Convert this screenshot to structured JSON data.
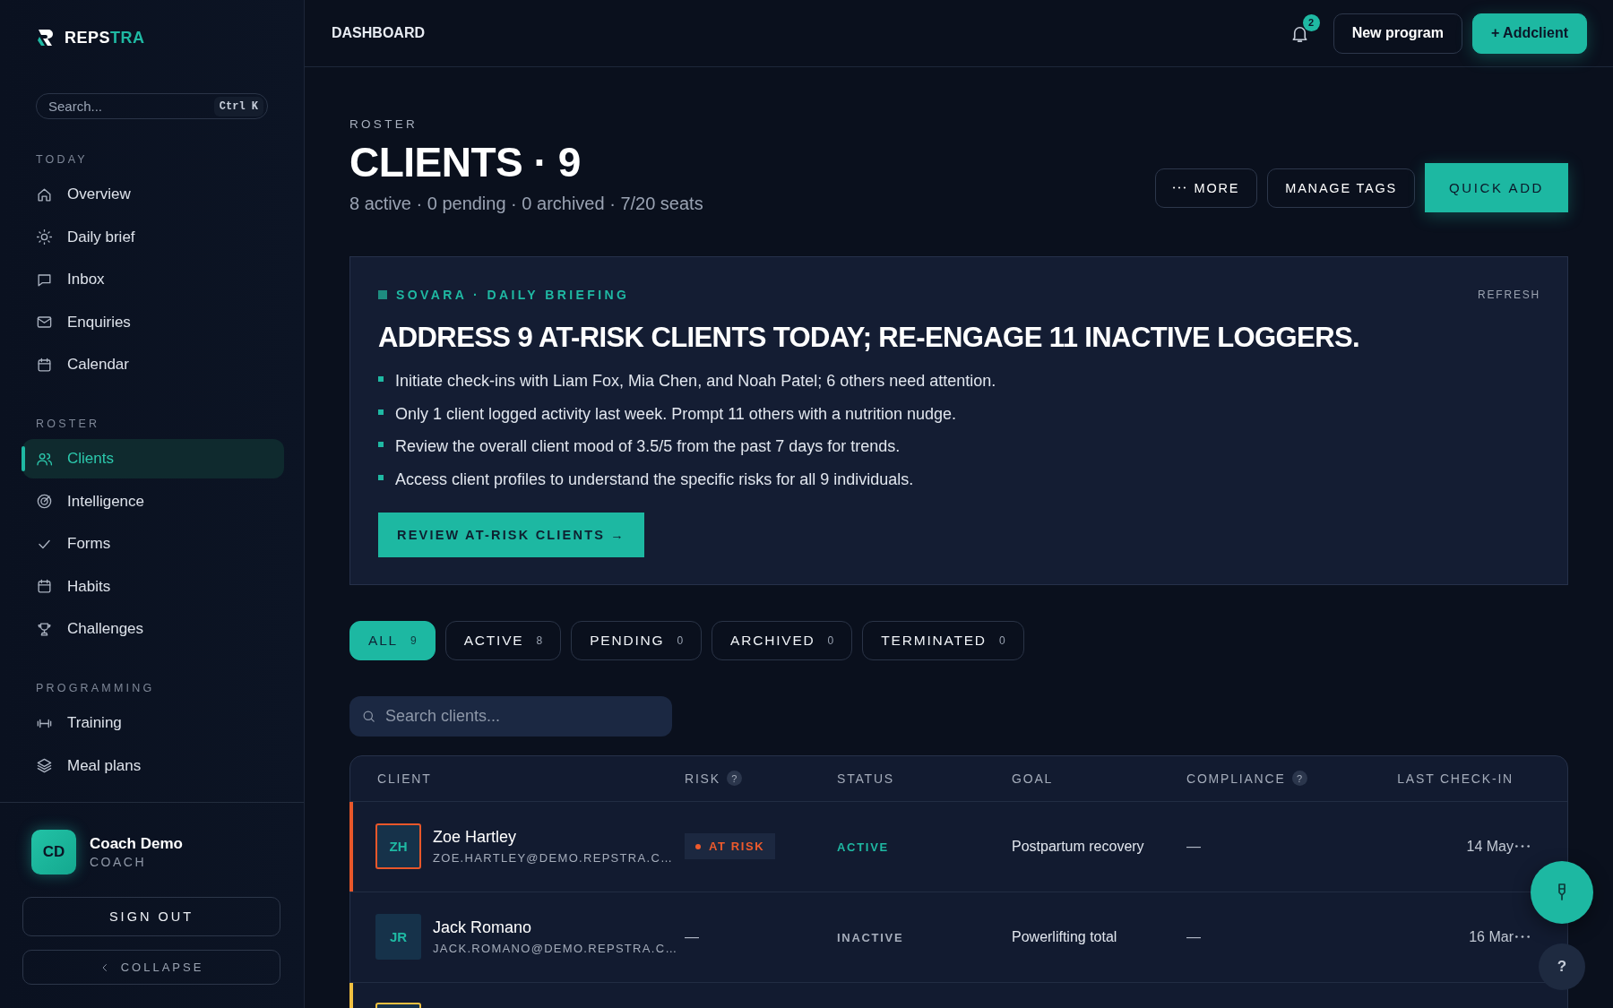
{
  "brand": {
    "lead": "REPS",
    "accent": "TRA"
  },
  "sidebar": {
    "search": {
      "placeholder": "Search...",
      "shortcut": "Ctrl K"
    },
    "sections": [
      {
        "title": "TODAY",
        "items": [
          {
            "label": "Overview",
            "selected": false
          },
          {
            "label": "Daily brief",
            "selected": false
          },
          {
            "label": "Inbox",
            "selected": false
          },
          {
            "label": "Enquiries",
            "selected": false
          },
          {
            "label": "Calendar",
            "selected": false
          }
        ]
      },
      {
        "title": "ROSTER",
        "items": [
          {
            "label": "Clients",
            "selected": true
          },
          {
            "label": "Intelligence",
            "selected": false
          },
          {
            "label": "Forms",
            "selected": false
          },
          {
            "label": "Habits",
            "selected": false
          },
          {
            "label": "Challenges",
            "selected": false
          }
        ]
      },
      {
        "title": "PROGRAMMING",
        "items": [
          {
            "label": "Training",
            "selected": false
          },
          {
            "label": "Meal plans",
            "selected": false
          }
        ]
      }
    ],
    "profile": {
      "initials": "CD",
      "name": "Coach Demo",
      "role": "COACH"
    },
    "sign_out": "SIGN OUT",
    "collapse": "COLLAPSE"
  },
  "header": {
    "title": "DASHBOARD",
    "notifications": "2",
    "buttons": [
      {
        "label": "New program",
        "kind": "outline"
      },
      {
        "label": "+ Addclient",
        "kind": "primary"
      }
    ]
  },
  "roster": {
    "eyebrow": "ROSTER",
    "title": "CLIENTS · 9",
    "summary": "8 active · 0 pending · 0 archived · 7/20 seats",
    "actions": [
      {
        "label": "MORE",
        "kind": "more"
      },
      {
        "label": "MANAGE TAGS",
        "kind": "outline"
      },
      {
        "label": "QUICK ADD",
        "kind": "primary"
      }
    ]
  },
  "briefing": {
    "eyebrow": "SOVARA · DAILY BRIEFING",
    "refresh": "REFRESH",
    "headline": "ADDRESS 9 AT-RISK CLIENTS TODAY; RE-ENGAGE 11 INACTIVE LOGGERS.",
    "bullets": [
      "Initiate check-ins with Liam Fox, Mia Chen, and Noah Patel; 6 others need attention.",
      "Only 1 client logged activity last week. Prompt 11 others with a nutrition nudge.",
      "Review the overall client mood of 3.5/5 from the past 7 days for trends.",
      "Access client profiles to understand the specific risks for all 9 individuals."
    ],
    "action": "REVIEW AT-RISK CLIENTS →"
  },
  "filters": [
    {
      "label": "ALL",
      "count": "9",
      "selected": true
    },
    {
      "label": "ACTIVE",
      "count": "8",
      "selected": false
    },
    {
      "label": "PENDING",
      "count": "0",
      "selected": false
    },
    {
      "label": "ARCHIVED",
      "count": "0",
      "selected": false
    },
    {
      "label": "TERMINATED",
      "count": "0",
      "selected": false
    }
  ],
  "client_search": {
    "placeholder": "Search clients..."
  },
  "table": {
    "columns": [
      {
        "label": "CLIENT"
      },
      {
        "label": "RISK",
        "hint": "?"
      },
      {
        "label": "STATUS"
      },
      {
        "label": "GOAL"
      },
      {
        "label": "COMPLIANCE",
        "hint": "?"
      },
      {
        "label": "LAST CHECK-IN"
      }
    ],
    "rows": [
      {
        "initials": "ZH",
        "name": "Zoe Hartley",
        "email": "ZOE.HARTLEY@DEMO.REPSTRA.C…",
        "color": "#e8572a",
        "risk": {
          "kind": "badge",
          "label": "AT RISK"
        },
        "status": {
          "kind": "active",
          "label": "ACTIVE"
        },
        "goal": "Postpartum recovery",
        "compliance": "—",
        "last_check_in": "14 May"
      },
      {
        "initials": "JR",
        "name": "Jack Romano",
        "email": "JACK.ROMANO@DEMO.REPSTRA.C…",
        "risk": {
          "kind": "none",
          "label": "—"
        },
        "status": {
          "kind": "inactive",
          "label": "INACTIVE"
        },
        "goal": "Powerlifting total",
        "compliance": "—",
        "last_check_in": "16 Mar"
      },
      {
        "color": "#f0c040"
      }
    ]
  },
  "help_button": "?"
}
